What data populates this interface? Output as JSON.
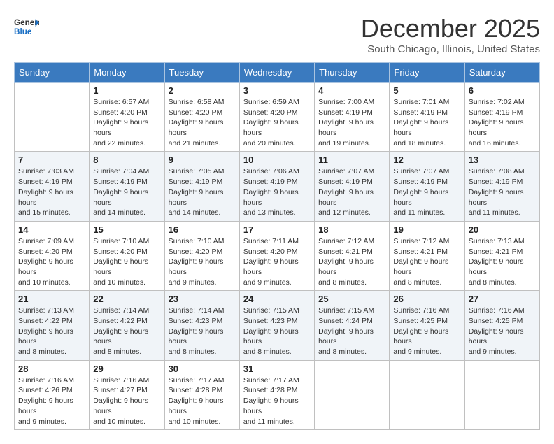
{
  "header": {
    "logo_line1": "General",
    "logo_line2": "Blue",
    "month_title": "December 2025",
    "location": "South Chicago, Illinois, United States"
  },
  "days_of_week": [
    "Sunday",
    "Monday",
    "Tuesday",
    "Wednesday",
    "Thursday",
    "Friday",
    "Saturday"
  ],
  "weeks": [
    [
      {
        "day": "",
        "sunrise": "",
        "sunset": "",
        "daylight": ""
      },
      {
        "day": "1",
        "sunrise": "Sunrise: 6:57 AM",
        "sunset": "Sunset: 4:20 PM",
        "daylight": "Daylight: 9 hours and 22 minutes."
      },
      {
        "day": "2",
        "sunrise": "Sunrise: 6:58 AM",
        "sunset": "Sunset: 4:20 PM",
        "daylight": "Daylight: 9 hours and 21 minutes."
      },
      {
        "day": "3",
        "sunrise": "Sunrise: 6:59 AM",
        "sunset": "Sunset: 4:20 PM",
        "daylight": "Daylight: 9 hours and 20 minutes."
      },
      {
        "day": "4",
        "sunrise": "Sunrise: 7:00 AM",
        "sunset": "Sunset: 4:19 PM",
        "daylight": "Daylight: 9 hours and 19 minutes."
      },
      {
        "day": "5",
        "sunrise": "Sunrise: 7:01 AM",
        "sunset": "Sunset: 4:19 PM",
        "daylight": "Daylight: 9 hours and 18 minutes."
      },
      {
        "day": "6",
        "sunrise": "Sunrise: 7:02 AM",
        "sunset": "Sunset: 4:19 PM",
        "daylight": "Daylight: 9 hours and 16 minutes."
      }
    ],
    [
      {
        "day": "7",
        "sunrise": "Sunrise: 7:03 AM",
        "sunset": "Sunset: 4:19 PM",
        "daylight": "Daylight: 9 hours and 15 minutes."
      },
      {
        "day": "8",
        "sunrise": "Sunrise: 7:04 AM",
        "sunset": "Sunset: 4:19 PM",
        "daylight": "Daylight: 9 hours and 14 minutes."
      },
      {
        "day": "9",
        "sunrise": "Sunrise: 7:05 AM",
        "sunset": "Sunset: 4:19 PM",
        "daylight": "Daylight: 9 hours and 14 minutes."
      },
      {
        "day": "10",
        "sunrise": "Sunrise: 7:06 AM",
        "sunset": "Sunset: 4:19 PM",
        "daylight": "Daylight: 9 hours and 13 minutes."
      },
      {
        "day": "11",
        "sunrise": "Sunrise: 7:07 AM",
        "sunset": "Sunset: 4:19 PM",
        "daylight": "Daylight: 9 hours and 12 minutes."
      },
      {
        "day": "12",
        "sunrise": "Sunrise: 7:07 AM",
        "sunset": "Sunset: 4:19 PM",
        "daylight": "Daylight: 9 hours and 11 minutes."
      },
      {
        "day": "13",
        "sunrise": "Sunrise: 7:08 AM",
        "sunset": "Sunset: 4:19 PM",
        "daylight": "Daylight: 9 hours and 11 minutes."
      }
    ],
    [
      {
        "day": "14",
        "sunrise": "Sunrise: 7:09 AM",
        "sunset": "Sunset: 4:20 PM",
        "daylight": "Daylight: 9 hours and 10 minutes."
      },
      {
        "day": "15",
        "sunrise": "Sunrise: 7:10 AM",
        "sunset": "Sunset: 4:20 PM",
        "daylight": "Daylight: 9 hours and 10 minutes."
      },
      {
        "day": "16",
        "sunrise": "Sunrise: 7:10 AM",
        "sunset": "Sunset: 4:20 PM",
        "daylight": "Daylight: 9 hours and 9 minutes."
      },
      {
        "day": "17",
        "sunrise": "Sunrise: 7:11 AM",
        "sunset": "Sunset: 4:20 PM",
        "daylight": "Daylight: 9 hours and 9 minutes."
      },
      {
        "day": "18",
        "sunrise": "Sunrise: 7:12 AM",
        "sunset": "Sunset: 4:21 PM",
        "daylight": "Daylight: 9 hours and 8 minutes."
      },
      {
        "day": "19",
        "sunrise": "Sunrise: 7:12 AM",
        "sunset": "Sunset: 4:21 PM",
        "daylight": "Daylight: 9 hours and 8 minutes."
      },
      {
        "day": "20",
        "sunrise": "Sunrise: 7:13 AM",
        "sunset": "Sunset: 4:21 PM",
        "daylight": "Daylight: 9 hours and 8 minutes."
      }
    ],
    [
      {
        "day": "21",
        "sunrise": "Sunrise: 7:13 AM",
        "sunset": "Sunset: 4:22 PM",
        "daylight": "Daylight: 9 hours and 8 minutes."
      },
      {
        "day": "22",
        "sunrise": "Sunrise: 7:14 AM",
        "sunset": "Sunset: 4:22 PM",
        "daylight": "Daylight: 9 hours and 8 minutes."
      },
      {
        "day": "23",
        "sunrise": "Sunrise: 7:14 AM",
        "sunset": "Sunset: 4:23 PM",
        "daylight": "Daylight: 9 hours and 8 minutes."
      },
      {
        "day": "24",
        "sunrise": "Sunrise: 7:15 AM",
        "sunset": "Sunset: 4:23 PM",
        "daylight": "Daylight: 9 hours and 8 minutes."
      },
      {
        "day": "25",
        "sunrise": "Sunrise: 7:15 AM",
        "sunset": "Sunset: 4:24 PM",
        "daylight": "Daylight: 9 hours and 8 minutes."
      },
      {
        "day": "26",
        "sunrise": "Sunrise: 7:16 AM",
        "sunset": "Sunset: 4:25 PM",
        "daylight": "Daylight: 9 hours and 9 minutes."
      },
      {
        "day": "27",
        "sunrise": "Sunrise: 7:16 AM",
        "sunset": "Sunset: 4:25 PM",
        "daylight": "Daylight: 9 hours and 9 minutes."
      }
    ],
    [
      {
        "day": "28",
        "sunrise": "Sunrise: 7:16 AM",
        "sunset": "Sunset: 4:26 PM",
        "daylight": "Daylight: 9 hours and 9 minutes."
      },
      {
        "day": "29",
        "sunrise": "Sunrise: 7:16 AM",
        "sunset": "Sunset: 4:27 PM",
        "daylight": "Daylight: 9 hours and 10 minutes."
      },
      {
        "day": "30",
        "sunrise": "Sunrise: 7:17 AM",
        "sunset": "Sunset: 4:28 PM",
        "daylight": "Daylight: 9 hours and 10 minutes."
      },
      {
        "day": "31",
        "sunrise": "Sunrise: 7:17 AM",
        "sunset": "Sunset: 4:28 PM",
        "daylight": "Daylight: 9 hours and 11 minutes."
      },
      {
        "day": "",
        "sunrise": "",
        "sunset": "",
        "daylight": ""
      },
      {
        "day": "",
        "sunrise": "",
        "sunset": "",
        "daylight": ""
      },
      {
        "day": "",
        "sunrise": "",
        "sunset": "",
        "daylight": ""
      }
    ]
  ]
}
